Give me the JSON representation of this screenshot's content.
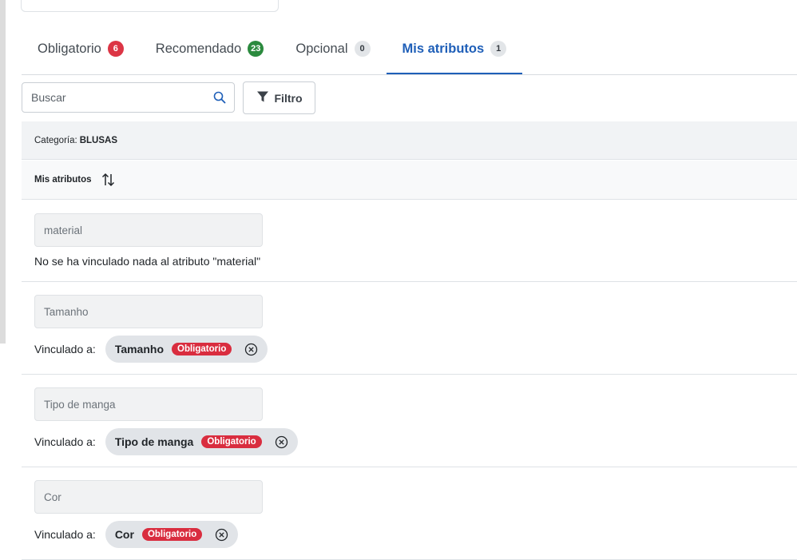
{
  "tabs": [
    {
      "label": "Obligatorio",
      "count": "6",
      "badge_color": "#dc3545",
      "active": false
    },
    {
      "label": "Recomendado",
      "count": "23",
      "badge_color": "#2b8a3e",
      "active": false
    },
    {
      "label": "Opcional",
      "count": "0",
      "badge_color": "#e2e5e8",
      "active": false
    },
    {
      "label": "Mis atributos",
      "count": "1",
      "badge_color": "#e2e5e8",
      "active": true
    }
  ],
  "toolbar": {
    "search_placeholder": "Buscar",
    "search_icon": "search-icon",
    "filter_label": "Filtro",
    "filter_icon": "filter-icon"
  },
  "category": {
    "label": "Categoría:",
    "value": "BLUSAS"
  },
  "table_header": {
    "label": "Mis atributos",
    "sort_icon": "sort-icon"
  },
  "attributes": [
    {
      "name": "material",
      "message": "No se ha vinculado nada al atributo \"material\""
    },
    {
      "name": "Tamanho",
      "linked_label": "Vinculado a:",
      "linked_name": "Tamanho",
      "linked_badge": "Obligatorio"
    },
    {
      "name": "Tipo de manga",
      "linked_label": "Vinculado a:",
      "linked_name": "Tipo de manga",
      "linked_badge": "Obligatorio"
    },
    {
      "name": "Cor",
      "linked_label": "Vinculado a:",
      "linked_name": "Cor",
      "linked_badge": "Obligatorio"
    }
  ],
  "colors": {
    "accent": "#1f5fb8",
    "required": "#d92d3f",
    "recommended": "#2b8a3e"
  }
}
